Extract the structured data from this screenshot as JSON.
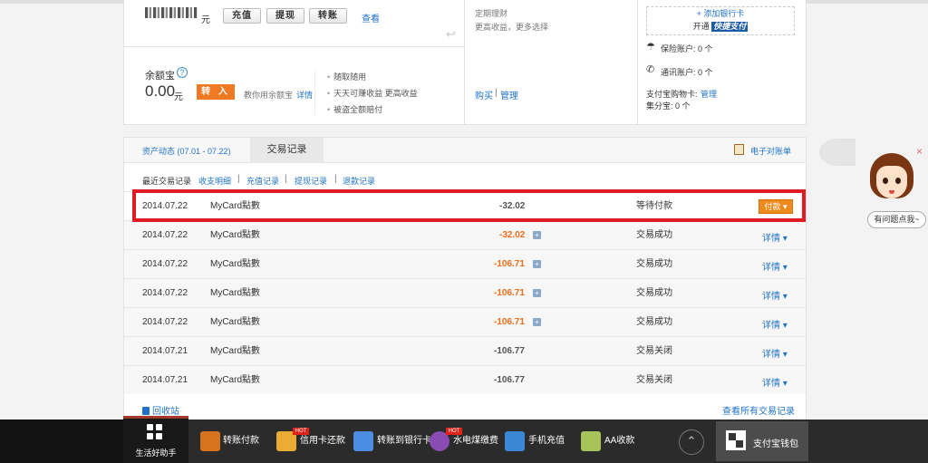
{
  "account": {
    "unit": "元",
    "buttons": [
      "充值",
      "提现",
      "转账"
    ],
    "view_link": "查看",
    "yuebao": {
      "title": "余额宝",
      "amount": "0.00",
      "unit": "元",
      "transfer_in": "转 入",
      "teach_text": "教你用余额宝",
      "detail": "详情",
      "features": [
        "随取随用",
        "天天可赚收益 更高收益",
        "被盗全额赔付"
      ]
    }
  },
  "investment": {
    "title": "定期理财",
    "desc": "更高收益，更多选择",
    "buy": "购买",
    "manage": "管理"
  },
  "bank": {
    "add_card": "+ 添加银行卡",
    "open": "开通",
    "quickpay": "快捷支付",
    "insurance": "保险账户: 0 个",
    "communication": "通讯账户: 0 个",
    "shopping_card": "支付宝购物卡:",
    "shopping_manage": "管理",
    "jifen": "集分宝: 0 个"
  },
  "tabs": {
    "asset_tab": "资产动态 (07.01 - 07.22)",
    "trade_tab": "交易记录",
    "bill": "电子对账单"
  },
  "subnav": {
    "recent": "最近交易记录",
    "items": [
      "收支明细",
      "充值记录",
      "提现记录",
      "退款记录"
    ]
  },
  "transactions": [
    {
      "date": "2014.07.22",
      "name": "MyCard點數",
      "amount": "-32.02",
      "status": "等待付款",
      "action": "付款 ▾",
      "color": "gray"
    },
    {
      "date": "2014.07.22",
      "name": "MyCard點數",
      "amount": "-32.02",
      "status": "交易成功",
      "action": "详情 ▾",
      "color": "orange"
    },
    {
      "date": "2014.07.22",
      "name": "MyCard點數",
      "amount": "-106.71",
      "status": "交易成功",
      "action": "详情 ▾",
      "color": "orange"
    },
    {
      "date": "2014.07.22",
      "name": "MyCard點數",
      "amount": "-106.71",
      "status": "交易成功",
      "action": "详情 ▾",
      "color": "orange"
    },
    {
      "date": "2014.07.22",
      "name": "MyCard點數",
      "amount": "-106.71",
      "status": "交易成功",
      "action": "详情 ▾",
      "color": "orange"
    },
    {
      "date": "2014.07.21",
      "name": "MyCard點數",
      "amount": "-106.77",
      "status": "交易关闭",
      "action": "详情 ▾",
      "color": "gray"
    },
    {
      "date": "2014.07.21",
      "name": "MyCard點數",
      "amount": "-106.77",
      "status": "交易关闭",
      "action": "详情 ▾",
      "color": "gray"
    }
  ],
  "footer": {
    "recycle": "回收站",
    "all_records": "查看所有交易记录"
  },
  "helper": {
    "bubble": "有问题点我~"
  },
  "taskbar": {
    "life_helper": "生活好助手",
    "items": [
      {
        "label": "转账付款"
      },
      {
        "label": "信用卡还款",
        "hot": "HOT"
      },
      {
        "label": "转账到银行卡"
      },
      {
        "label": "水电煤缴费",
        "hot": "HOT"
      },
      {
        "label": "手机充值"
      },
      {
        "label": "AA收款"
      }
    ],
    "wallet": "支付宝钱包"
  }
}
